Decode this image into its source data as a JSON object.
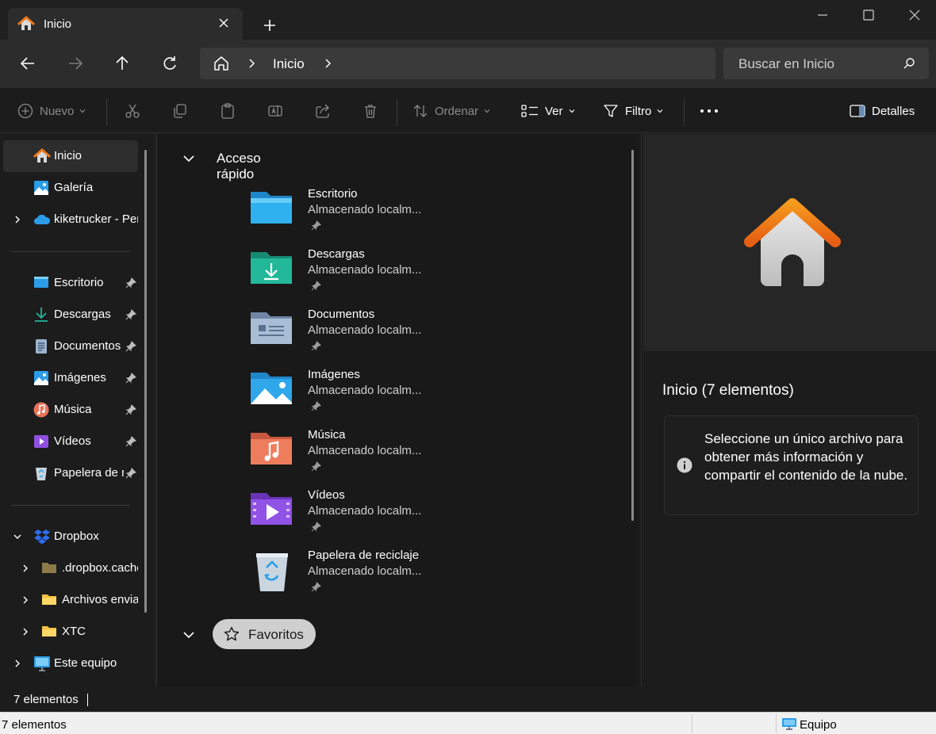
{
  "window": {
    "tab_title": "Inicio"
  },
  "address": {
    "crumbs": [
      "Inicio"
    ]
  },
  "search": {
    "placeholder": "Buscar en Inicio"
  },
  "toolbar": {
    "new_label": "Nuevo",
    "sort_label": "Ordenar",
    "view_label": "Ver",
    "filter_label": "Filtro",
    "details_label": "Detalles"
  },
  "sidebar": {
    "items": [
      {
        "label": "Inicio",
        "icon": "home-icon",
        "selected": true
      },
      {
        "label": "Galería",
        "icon": "gallery-icon"
      },
      {
        "label": "kiketrucker - Personal",
        "icon": "onedrive-icon",
        "expandable": true
      },
      {
        "label": "Escritorio",
        "icon": "desktop-folder-icon",
        "pinned": true
      },
      {
        "label": "Descargas",
        "icon": "download-icon",
        "pinned": true
      },
      {
        "label": "Documentos",
        "icon": "documents-icon",
        "pinned": true
      },
      {
        "label": "Imágenes",
        "icon": "pictures-icon",
        "pinned": true
      },
      {
        "label": "Música",
        "icon": "music-icon",
        "pinned": true
      },
      {
        "label": "Vídeos",
        "icon": "videos-icon",
        "pinned": true
      },
      {
        "label": "Papelera de reciclaje",
        "icon": "recycle-bin-icon",
        "pinned": true
      },
      {
        "label": "Dropbox",
        "icon": "dropbox-icon",
        "expanded": true
      },
      {
        "label": ".dropbox.cache",
        "icon": "folder-icon",
        "expandable": true
      },
      {
        "label": "Archivos enviados",
        "icon": "folder-icon",
        "expandable": true
      },
      {
        "label": "XTC",
        "icon": "folder-icon",
        "expandable": true
      },
      {
        "label": "Este equipo",
        "icon": "this-pc-icon",
        "expandable": true
      }
    ]
  },
  "content": {
    "quick_access_title": "Acceso rápido",
    "favorites_title": "Favoritos",
    "items": [
      {
        "name": "Escritorio",
        "location": "Almacenado localm...",
        "icon": "desktop-folder-icon"
      },
      {
        "name": "Descargas",
        "location": "Almacenado localm...",
        "icon": "downloads-folder-icon"
      },
      {
        "name": "Documentos",
        "location": "Almacenado localm...",
        "icon": "documents-folder-icon"
      },
      {
        "name": "Imágenes",
        "location": "Almacenado localm...",
        "icon": "pictures-folder-icon"
      },
      {
        "name": "Música",
        "location": "Almacenado localm...",
        "icon": "music-folder-icon"
      },
      {
        "name": "Vídeos",
        "location": "Almacenado localm...",
        "icon": "videos-folder-icon"
      },
      {
        "name": "Papelera de reciclaje",
        "location": "Almacenado localm...",
        "icon": "recycle-bin-icon"
      }
    ]
  },
  "details_pane": {
    "title": "Inicio (7 elementos)",
    "message": "Seleccione un único archivo para obtener más información y compartir el contenido de la nube."
  },
  "status": {
    "item_count": "7 elementos",
    "legacy_item_count": "7 elementos",
    "legacy_zone": "Equipo"
  },
  "colors": {
    "accent_orange": "#f27a1a",
    "folder_blue": "#2b9de8",
    "folder_teal": "#21b59a"
  }
}
